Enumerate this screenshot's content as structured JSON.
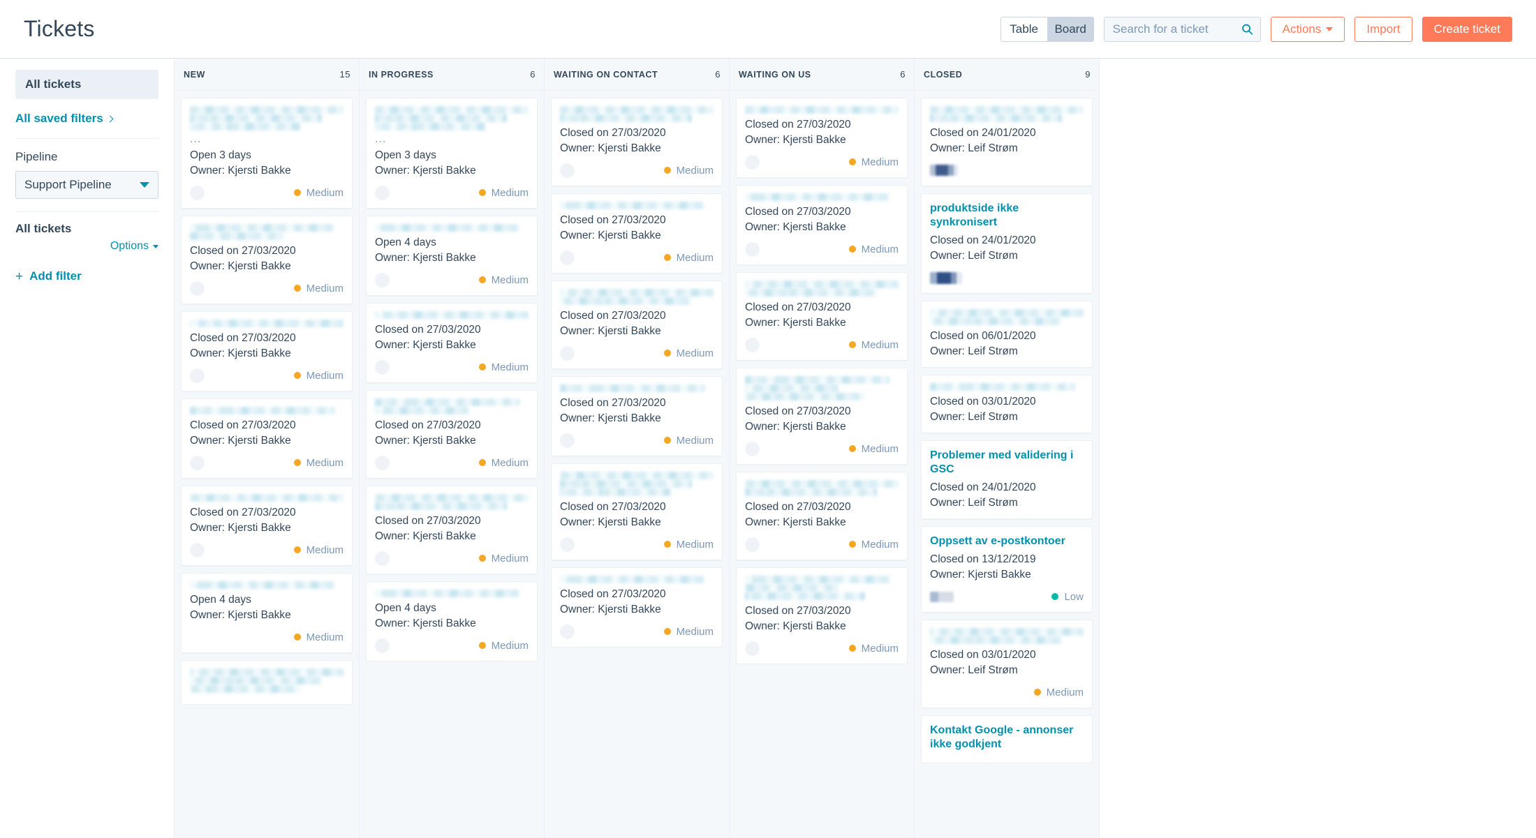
{
  "header": {
    "title": "Tickets",
    "view_toggle": {
      "options": [
        "Table",
        "Board"
      ],
      "selected": "Board"
    },
    "search": {
      "placeholder": "Search for a ticket",
      "value": "",
      "icon": "search-icon"
    },
    "actions_label": "Actions",
    "import_label": "Import",
    "create_label": "Create ticket"
  },
  "sidebar": {
    "all_tickets_label": "All tickets",
    "saved_filters_label": "All saved filters",
    "pipeline_label": "Pipeline",
    "pipeline_value": "Support Pipeline",
    "filters_heading": "All tickets",
    "options_label": "Options",
    "add_filter_label": "Add filter"
  },
  "colors": {
    "accent_orange": "#ff7a59",
    "link_teal": "#0091ae",
    "priority_medium": "#f5a623",
    "priority_low": "#00bda5",
    "column_bg": "#f5f8fa",
    "border": "#eaf0f6"
  },
  "priority_labels": {
    "medium": "Medium",
    "low": "Low"
  },
  "columns": [
    {
      "name": "NEW",
      "count": "15",
      "cards": [
        {
          "title": null,
          "redact_lines": 3,
          "ellipsis": true,
          "status": "Open 3 days",
          "owner": "Owner: Kjersti Bakke",
          "avatar": "blank",
          "priority": "Medium",
          "priority_color": "#f5a623"
        },
        {
          "title": null,
          "redact_lines": 2,
          "status": "Closed on 27/03/2020",
          "owner": "Owner: Kjersti Bakke",
          "avatar": "blank",
          "priority": "Medium",
          "priority_color": "#f5a623"
        },
        {
          "title": null,
          "redact_lines": 1,
          "status": "Closed on 27/03/2020",
          "owner": "Owner: Kjersti Bakke",
          "avatar": "blank",
          "priority": "Medium",
          "priority_color": "#f5a623"
        },
        {
          "title": null,
          "redact_lines": 1,
          "status": "Closed on 27/03/2020",
          "owner": "Owner: Kjersti Bakke",
          "avatar": "blank",
          "priority": "Medium",
          "priority_color": "#f5a623"
        },
        {
          "title": null,
          "redact_lines": 1,
          "status": "Closed on 27/03/2020",
          "owner": "Owner: Kjersti Bakke",
          "avatar": "blank",
          "priority": "Medium",
          "priority_color": "#f5a623"
        },
        {
          "title": null,
          "redact_lines": 1,
          "status": "Open 4 days",
          "owner": "Owner: Kjersti Bakke",
          "avatar": "none",
          "priority": "Medium",
          "priority_color": "#f5a623"
        },
        {
          "title": null,
          "redact_lines": 3,
          "status": "",
          "owner": "",
          "avatar": "none",
          "priority": "",
          "priority_color": "#f5a623"
        }
      ]
    },
    {
      "name": "IN PROGRESS",
      "count": "6",
      "cards": [
        {
          "title": null,
          "redact_lines": 3,
          "ellipsis": true,
          "status": "Open 3 days",
          "owner": "Owner: Kjersti Bakke",
          "avatar": "blank",
          "priority": "Medium",
          "priority_color": "#f5a623"
        },
        {
          "title": null,
          "redact_lines": 1,
          "status": "Open 4 days",
          "owner": "Owner: Kjersti Bakke",
          "avatar": "blank",
          "priority": "Medium",
          "priority_color": "#f5a623"
        },
        {
          "title": null,
          "redact_lines": 1,
          "status": "Closed on 27/03/2020",
          "owner": "Owner: Kjersti Bakke",
          "avatar": "blank",
          "priority": "Medium",
          "priority_color": "#f5a623"
        },
        {
          "title": null,
          "redact_lines": 2,
          "status": "Closed on 27/03/2020",
          "owner": "Owner: Kjersti Bakke",
          "avatar": "blank",
          "priority": "Medium",
          "priority_color": "#f5a623"
        },
        {
          "title": null,
          "redact_lines": 2,
          "status": "Closed on 27/03/2020",
          "owner": "Owner: Kjersti Bakke",
          "avatar": "blank",
          "priority": "Medium",
          "priority_color": "#f5a623"
        },
        {
          "title": null,
          "redact_lines": 1,
          "status": "Open 4 days",
          "owner": "Owner: Kjersti Bakke",
          "avatar": "blank",
          "priority": "Medium",
          "priority_color": "#f5a623"
        }
      ]
    },
    {
      "name": "WAITING ON CONTACT",
      "count": "6",
      "cards": [
        {
          "title": null,
          "redact_lines": 2,
          "status": "Closed on 27/03/2020",
          "owner": "Owner: Kjersti Bakke",
          "avatar": "blank",
          "priority": "Medium",
          "priority_color": "#f5a623"
        },
        {
          "title": null,
          "redact_lines": 1,
          "status": "Closed on 27/03/2020",
          "owner": "Owner: Kjersti Bakke",
          "avatar": "blank",
          "priority": "Medium",
          "priority_color": "#f5a623"
        },
        {
          "title": null,
          "redact_lines": 2,
          "status": "Closed on 27/03/2020",
          "owner": "Owner: Kjersti Bakke",
          "avatar": "blank",
          "priority": "Medium",
          "priority_color": "#f5a623"
        },
        {
          "title": null,
          "redact_lines": 1,
          "status": "Closed on 27/03/2020",
          "owner": "Owner: Kjersti Bakke",
          "avatar": "blank",
          "priority": "Medium",
          "priority_color": "#f5a623"
        },
        {
          "title": null,
          "redact_lines": 3,
          "status": "Closed on 27/03/2020",
          "owner": "Owner: Kjersti Bakke",
          "avatar": "blank",
          "priority": "Medium",
          "priority_color": "#f5a623"
        },
        {
          "title": null,
          "redact_lines": 1,
          "status": "Closed on 27/03/2020",
          "owner": "Owner: Kjersti Bakke",
          "avatar": "blank",
          "priority": "Medium",
          "priority_color": "#f5a623"
        }
      ]
    },
    {
      "name": "WAITING ON US",
      "count": "6",
      "cards": [
        {
          "title": null,
          "redact_lines": 1,
          "status": "Closed on 27/03/2020",
          "owner": "Owner: Kjersti Bakke",
          "avatar": "blank",
          "priority": "Medium",
          "priority_color": "#f5a623"
        },
        {
          "title": null,
          "redact_lines": 1,
          "status": "Closed on 27/03/2020",
          "owner": "Owner: Kjersti Bakke",
          "avatar": "blank",
          "priority": "Medium",
          "priority_color": "#f5a623"
        },
        {
          "title": null,
          "redact_lines": 2,
          "status": "Closed on 27/03/2020",
          "owner": "Owner: Kjersti Bakke",
          "avatar": "blank",
          "priority": "Medium",
          "priority_color": "#f5a623"
        },
        {
          "title": null,
          "redact_lines": 3,
          "status": "Closed on 27/03/2020",
          "owner": "Owner: Kjersti Bakke",
          "avatar": "blank",
          "priority": "Medium",
          "priority_color": "#f5a623"
        },
        {
          "title": null,
          "redact_lines": 2,
          "status": "Closed on 27/03/2020",
          "owner": "Owner: Kjersti Bakke",
          "avatar": "blank",
          "priority": "Medium",
          "priority_color": "#f5a623"
        },
        {
          "title": null,
          "redact_lines": 3,
          "status": "Closed on 27/03/2020",
          "owner": "Owner: Kjersti Bakke",
          "avatar": "blank",
          "priority": "Medium",
          "priority_color": "#f5a623"
        }
      ]
    },
    {
      "name": "CLOSED",
      "count": "9",
      "cards": [
        {
          "title": null,
          "redact_lines": 2,
          "status": "Closed on 24/01/2020",
          "owner": "Owner: Leif Strøm",
          "avatar": "dark",
          "priority": "",
          "priority_color": "#f5a623"
        },
        {
          "title": "produktside ikke synkronisert",
          "status": "Closed on 24/01/2020",
          "owner": "Owner: Leif Strøm",
          "avatar": "dark2",
          "priority": "",
          "priority_color": "#f5a623"
        },
        {
          "title": null,
          "redact_lines": 2,
          "status": "Closed on 06/01/2020",
          "owner": "Owner: Leif Strøm",
          "avatar": "none",
          "priority": "",
          "priority_color": "#f5a623"
        },
        {
          "title": null,
          "redact_lines": 1,
          "status": "Closed on 03/01/2020",
          "owner": "Owner: Leif Strøm",
          "avatar": "none",
          "priority": "",
          "priority_color": "#f5a623"
        },
        {
          "title": "Problemer med validering i GSC",
          "status": "Closed on 24/01/2020",
          "owner": "Owner: Leif Strøm",
          "avatar": "none",
          "priority": "",
          "priority_color": "#f5a623"
        },
        {
          "title": "Oppsett av e-postkontoer",
          "status": "Closed on 13/12/2019",
          "owner": "Owner: Kjersti Bakke",
          "avatar": "dark3",
          "priority": "Low",
          "priority_color": "#00bda5"
        },
        {
          "title": null,
          "redact_lines": 2,
          "status": "Closed on 03/01/2020",
          "owner": "Owner: Leif Strøm",
          "avatar": "none",
          "priority": "Medium",
          "priority_color": "#f5a623"
        },
        {
          "title": "Kontakt Google - annonser ikke godkjent",
          "status": "",
          "owner": "",
          "avatar": "none",
          "priority": "",
          "priority_color": "#f5a623"
        }
      ]
    }
  ]
}
